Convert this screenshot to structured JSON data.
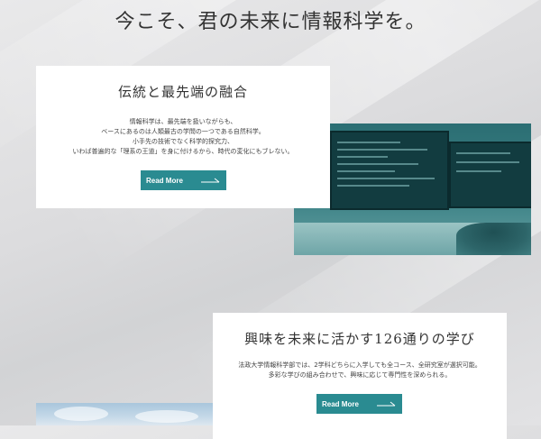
{
  "page": {
    "heading": "今こそ、君の未来に情報科学を。"
  },
  "sections": [
    {
      "title": "伝統と最先端の融合",
      "body": [
        "情報科学は、最先端を扱いながらも、",
        "ベースにあるのは人類最古の学問の一つである自然科学。",
        "小手先の技術でなく科学的探究力、",
        "いわば普遍的な「理系の王道」を身に付けるから、時代の変化にもブレない。"
      ],
      "button_label": "Read More",
      "button_icon": "arrow-right-icon"
    },
    {
      "title": "興味を未来に活かす126通りの学び",
      "body": [
        "法政大学情報科学部では、2学科どちらに入学しても全コース、全研究室が選択可能。",
        "多彩な学びの組み合わせで、興味に応じて専門性を深められる。"
      ],
      "button_label": "Read More",
      "button_icon": "arrow-right-icon"
    }
  ],
  "colors": {
    "accent": "#2a8b91",
    "text": "#333333",
    "card": "#ffffff"
  }
}
